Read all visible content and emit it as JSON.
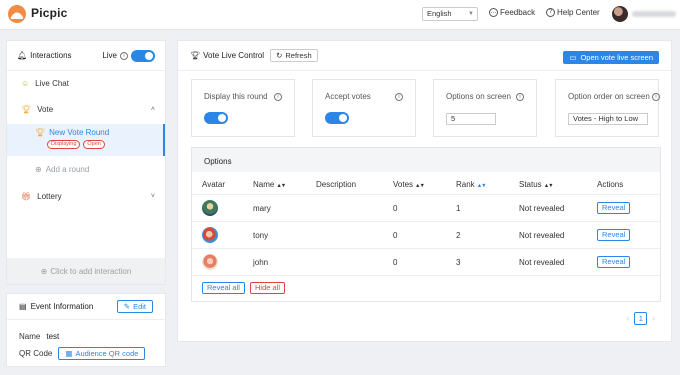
{
  "app": {
    "name": "Picpic"
  },
  "header": {
    "language": "English",
    "feedback_label": "Feedback",
    "help_label": "Help Center"
  },
  "sidebar": {
    "section_title": "Interactions",
    "live_label": "Live",
    "live_on": true,
    "items": [
      {
        "label": "Live Chat"
      },
      {
        "label": "Vote"
      },
      {
        "label": "Lottery"
      }
    ],
    "vote_round": {
      "name": "New Vote Round",
      "badges": [
        "Displaying",
        "Open"
      ]
    },
    "add_round_label": "Add a round",
    "click_add_label": "Click to add interaction"
  },
  "event": {
    "title": "Event Information",
    "edit_label": "Edit",
    "name_label": "Name",
    "name_value": "test",
    "qr_label": "QR Code",
    "qr_button": "Audience QR code"
  },
  "main": {
    "title": "Vote Live Control",
    "refresh_label": "Refresh",
    "open_screen_label": "Open vote live screen",
    "cards": [
      {
        "label": "Display this round",
        "kind": "toggle",
        "on": true
      },
      {
        "label": "Accept votes",
        "kind": "toggle",
        "on": true
      },
      {
        "label": "Options on screen",
        "kind": "number",
        "value": "5"
      },
      {
        "label": "Option order on screen",
        "kind": "select",
        "value": "Votes - High to Low"
      }
    ],
    "options": {
      "title": "Options",
      "columns": [
        "Avatar",
        "Name",
        "Description",
        "Votes",
        "Rank",
        "Status",
        "Actions"
      ],
      "rows": [
        {
          "name": "mary",
          "description": "",
          "votes": "0",
          "rank": "1",
          "status": "Not revealed",
          "action": "Reveal"
        },
        {
          "name": "tony",
          "description": "",
          "votes": "0",
          "rank": "2",
          "status": "Not revealed",
          "action": "Reveal"
        },
        {
          "name": "john",
          "description": "",
          "votes": "0",
          "rank": "3",
          "status": "Not revealed",
          "action": "Reveal"
        }
      ],
      "reveal_all_label": "Reveal all",
      "hide_all_label": "Hide all"
    },
    "pagination": {
      "current": "1"
    }
  },
  "colors": {
    "accent": "#2c86e6",
    "danger": "#e04545",
    "logo": "#f28b44"
  }
}
